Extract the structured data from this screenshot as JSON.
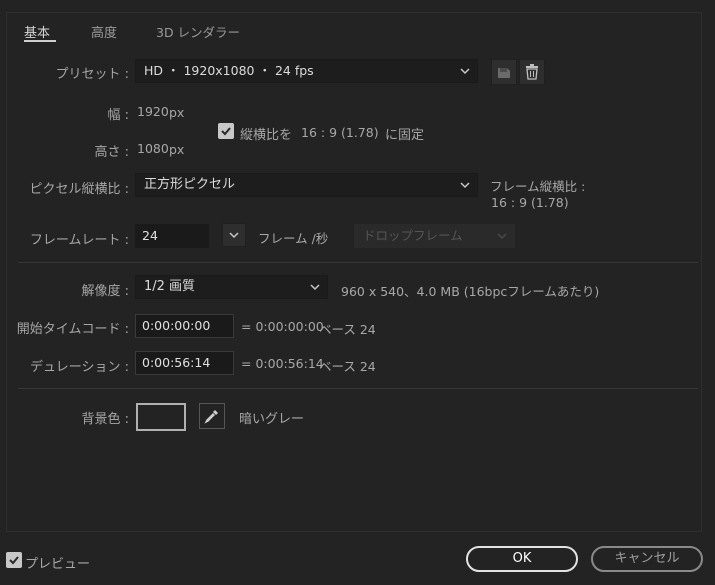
{
  "tabs": [
    {
      "label": "基本"
    },
    {
      "label": "高度"
    },
    {
      "label": "3D レンダラー"
    }
  ],
  "preset": {
    "label": "プリセット :",
    "value": "HD ・ 1920x1080 ・ 24 fps"
  },
  "width": {
    "label": "幅 :",
    "value": "1920",
    "unit": "px"
  },
  "height": {
    "label": "高さ :",
    "value": "1080",
    "unit": "px"
  },
  "lock_aspect": {
    "label": "縦横比を",
    "ratio": "16 : 9 (1.78)",
    "suffix": "に固定",
    "checked": true
  },
  "pixel_aspect": {
    "label": "ピクセル縦横比 :",
    "value": "正方形ピクセル",
    "frame_aspect_label": "フレーム縦横比 :",
    "frame_aspect_value": "16 : 9 (1.78)"
  },
  "frame_rate": {
    "label": "フレームレート :",
    "value": "24",
    "unit": "フレーム /秒",
    "drop_frame": "ドロップフレーム"
  },
  "resolution": {
    "label": "解像度 :",
    "value": "1/2 画質",
    "info": "960 x 540、4.0 MB (16bpcフレームあたり)"
  },
  "start_timecode": {
    "label": "開始タイムコード :",
    "value": "0:00:00:00",
    "eq": "= 0:00:00:00",
    "base": "ベース 24"
  },
  "duration": {
    "label": "デュレーション :",
    "value": "0:00:56:14",
    "eq": "= 0:00:56:14",
    "base": "ベース 24"
  },
  "background": {
    "label": "背景色 :",
    "color_name": "暗いグレー",
    "swatch_color": "#232323"
  },
  "footer": {
    "preview_label": "プレビュー",
    "preview_checked": true,
    "ok": "OK",
    "cancel": "キャンセル"
  },
  "colors": {
    "accent_blue": "#3e8ee6",
    "background": "#232323"
  }
}
